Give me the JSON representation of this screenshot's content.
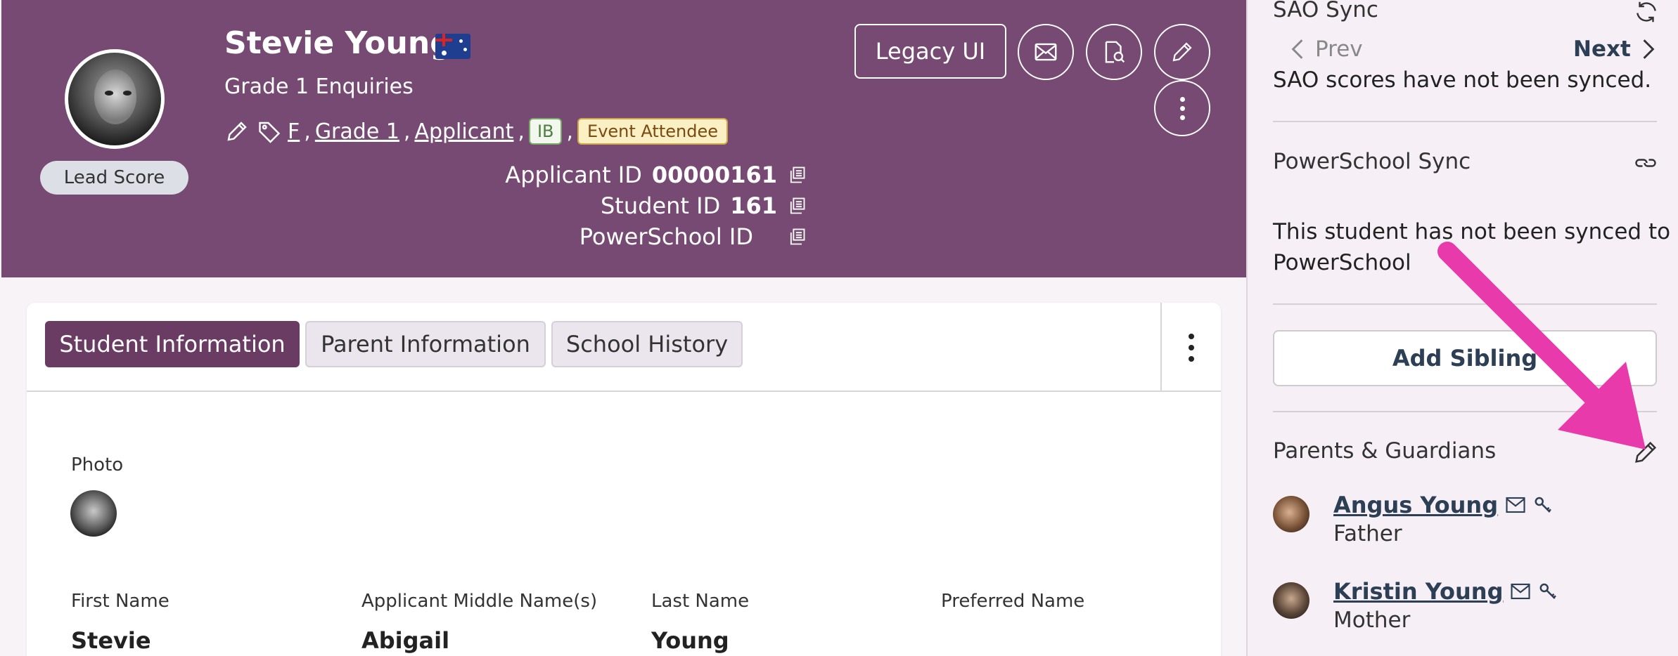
{
  "header": {
    "student_name": "Stevie Young",
    "subtitle": "Grade 1 Enquiries",
    "tags": [
      "F",
      "Grade 1",
      "Applicant"
    ],
    "badge_ib": "IB",
    "badge_event": "Event Attendee",
    "lead_score_label": "Lead Score",
    "legacy_button": "Legacy UI",
    "applicant_id_label": "Applicant ID",
    "applicant_id_value": "00000161",
    "student_id_label": "Student ID",
    "student_id_value": "161",
    "powerschool_id_label": "PowerSchool ID",
    "colors": {
      "header_bg": "#764a72",
      "tab_active": "#6a3c64"
    }
  },
  "tabs": [
    {
      "label": "Student Information",
      "active": true
    },
    {
      "label": "Parent Information",
      "active": false
    },
    {
      "label": "School History",
      "active": false
    }
  ],
  "form": {
    "photo_label": "Photo",
    "first_name_label": "First Name",
    "first_name_value": "Stevie",
    "middle_name_label": "Applicant Middle Name(s)",
    "middle_name_value": "Abigail",
    "last_name_label": "Last Name",
    "last_name_value": "Young",
    "preferred_name_label": "Preferred Name"
  },
  "sidebar": {
    "sao_title": "SAO Sync",
    "prev_label": "Prev",
    "next_label": "Next",
    "sao_message": "SAO scores have not been synced.",
    "ps_title": "PowerSchool Sync",
    "ps_message_line1": "This student has not been synced to",
    "ps_message_line2": "PowerSchool",
    "add_sibling": "Add Sibling",
    "parents_title": "Parents & Guardians",
    "parents": [
      {
        "name": "Angus Young",
        "relation": "Father"
      },
      {
        "name": "Kristin Young",
        "relation": "Mother"
      }
    ]
  }
}
